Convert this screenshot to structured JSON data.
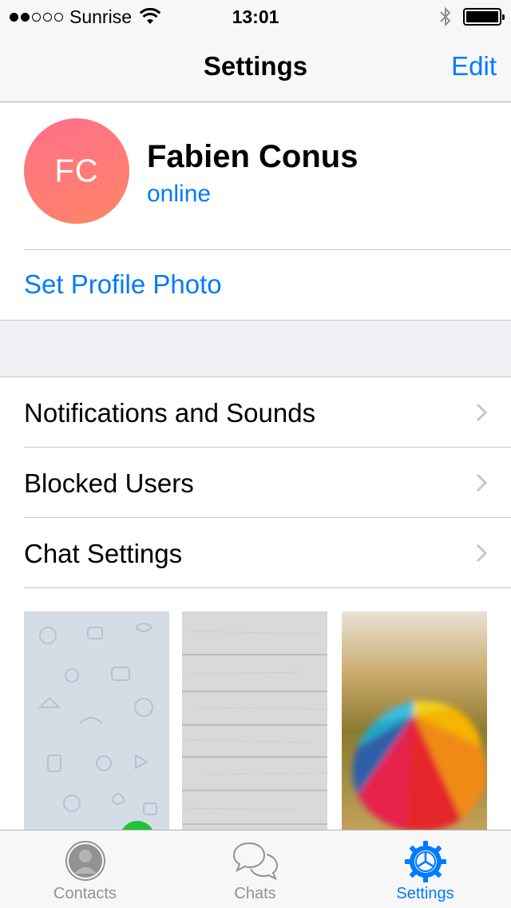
{
  "status_bar": {
    "carrier": "Sunrise",
    "time": "13:01",
    "signal_bars_filled": 2,
    "signal_bars_total": 5,
    "battery_level": 1.0
  },
  "nav": {
    "title": "Settings",
    "edit_label": "Edit"
  },
  "profile": {
    "initials": "FC",
    "name": "Fabien Conus",
    "status": "online",
    "set_photo_label": "Set Profile Photo"
  },
  "menu": {
    "items": [
      {
        "label": "Notifications and Sounds"
      },
      {
        "label": "Blocked Users"
      },
      {
        "label": "Chat Settings"
      }
    ]
  },
  "tabs": [
    {
      "label": "Contacts",
      "icon": "person-icon",
      "active": false
    },
    {
      "label": "Chats",
      "icon": "chat-bubbles-icon",
      "active": false
    },
    {
      "label": "Settings",
      "icon": "gear-icon",
      "active": true
    }
  ],
  "colors": {
    "accent": "#007aff",
    "avatar_gradient_start": "#ff6f8b",
    "avatar_gradient_end": "#ff8566",
    "selected_wallpaper_badge": "#1fc43a"
  }
}
